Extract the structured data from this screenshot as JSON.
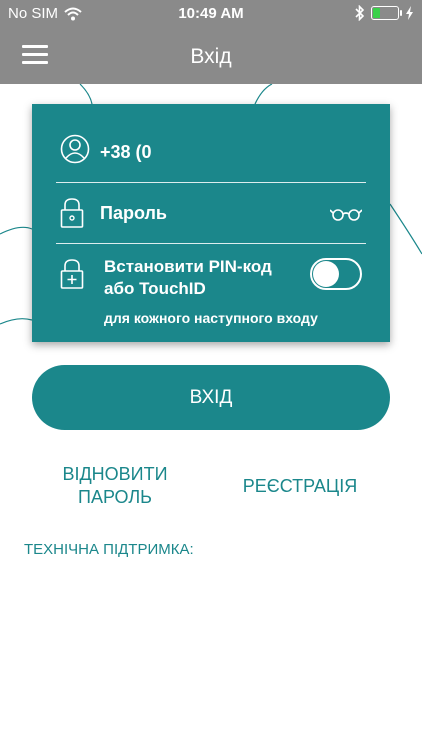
{
  "status_bar": {
    "carrier": "No SIM",
    "time": "10:49 AM"
  },
  "nav": {
    "title": "Вхід"
  },
  "form": {
    "phone_value": "+38 (0",
    "password_placeholder": "Пароль",
    "pin_label": "Встановити PIN-код або  TouchID",
    "pin_subtext": "для кожного наступного входу",
    "pin_enabled": false
  },
  "actions": {
    "login_label": "ВХІД",
    "recover_label": "ВІДНОВИТИ ПАРОЛЬ",
    "register_label": "РЕЄСТРАЦІЯ",
    "support_label": "ТЕХНІЧНА ПІДТРИМКА:"
  },
  "colors": {
    "accent": "#1b878b",
    "bar": "#8a8a8a",
    "battery": "#3ad04a"
  },
  "icons": [
    "menu-icon",
    "user-icon",
    "lock-icon",
    "eye-glasses-icon",
    "lock-plus-icon",
    "wifi-icon",
    "bluetooth-icon",
    "battery-icon",
    "charging-icon"
  ]
}
